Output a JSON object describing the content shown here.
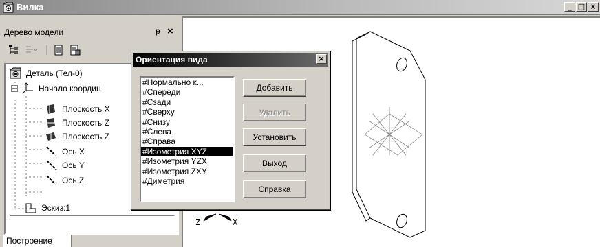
{
  "window": {
    "title": "Вилка",
    "min": "_",
    "max": "□",
    "close": "×"
  },
  "panel": {
    "title": "Дерево модели",
    "pin": "ᵽ",
    "close": "×",
    "tree": [
      {
        "label": "Деталь (Тел-0)"
      },
      {
        "label": "Начало координ"
      },
      {
        "label": "Плоскость X"
      },
      {
        "label": "Плоскость Z"
      },
      {
        "label": "Плоскость Z"
      },
      {
        "label": "Ось X"
      },
      {
        "label": "Ось Y"
      },
      {
        "label": "Ось Z"
      },
      {
        "label": "Эскиз:1"
      }
    ],
    "tab": "Построение"
  },
  "viewport": {
    "axis_z": "Z",
    "axis_x": "X"
  },
  "dialog": {
    "title": "Ориентация вида",
    "close": "×",
    "list": [
      "#Нормально к...",
      "#Спереди",
      "#Сзади",
      "#Сверху",
      "#Снизу",
      "#Слева",
      "#Справа",
      "#Изометрия XYZ",
      "#Изометрия YZX",
      "#Изометрия ZXY",
      "#Диметрия"
    ],
    "selected_index": 7,
    "buttons": {
      "add": "Добавить",
      "delete": "Удалить",
      "set": "Установить",
      "exit": "Выход",
      "help": "Справка"
    }
  }
}
